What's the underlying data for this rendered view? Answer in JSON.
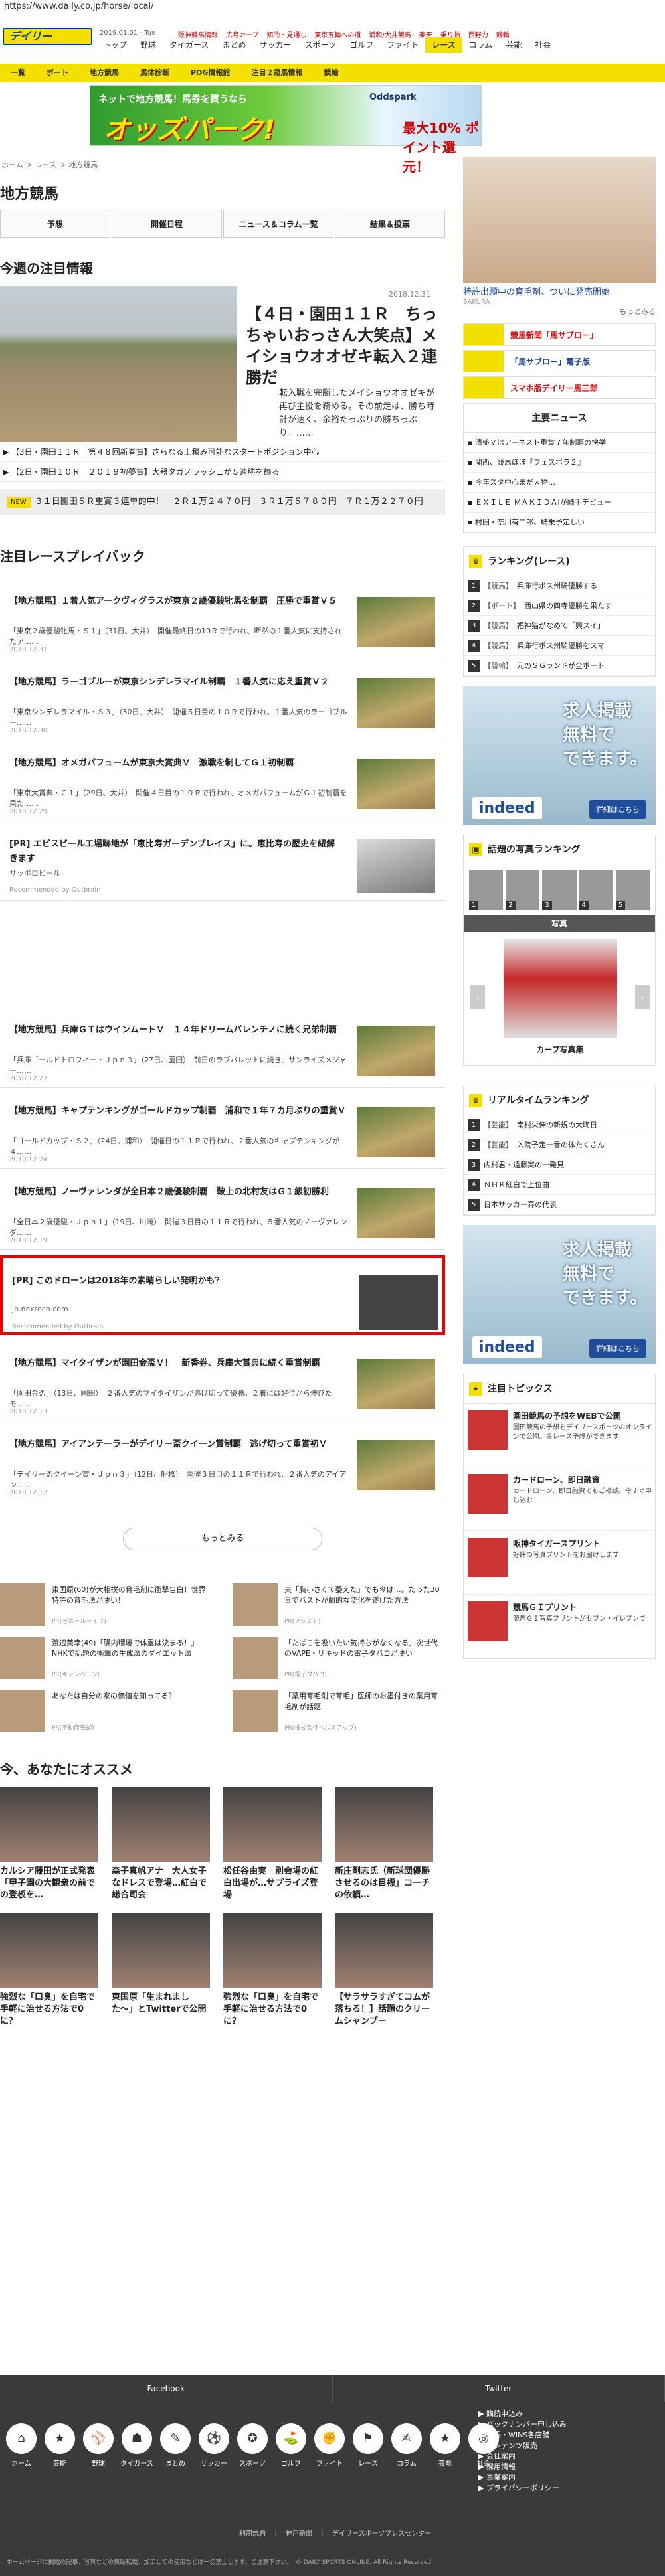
{
  "browser": {
    "url": "https://www.daily.co.jp/horse/local/"
  },
  "header": {
    "logo": "デイリー",
    "date": "2019.01.01 - Tue",
    "top_links": [
      "阪神競馬情報",
      "広島カープ",
      "知的・見通し",
      "東京五輪への道",
      "浦和/大井競馬",
      "楽天",
      "乗り物",
      "西野力",
      "競輪"
    ],
    "nav": [
      "トップ",
      "野球",
      "タイガース",
      "まとめ",
      "サッカー",
      "スポーツ",
      "ゴルフ",
      "ファイト",
      "レース",
      "コラム",
      "芸能",
      "社会"
    ],
    "nav_active": "レース"
  },
  "subnav": [
    "一覧",
    "ボート",
    "地方競馬",
    "馬体診断",
    "POG情報館",
    "注目２歳馬情報",
    "競輪"
  ],
  "banner": {
    "top": "ネットで地方競馬！馬券を買うなら",
    "main": "オッズパーク!",
    "brand": "Oddspark",
    "promo": "最大10% ポイント還元！"
  },
  "breadcrumb": "ホーム ＞ レース ＞ 地方競馬",
  "page_title": "地方競馬",
  "tabs": [
    "予想",
    "開催日程",
    "ニュース＆コラム一覧",
    "結果＆投票"
  ],
  "featured": {
    "section": "今週の注目情報",
    "date": "2018.12.31",
    "headline": "【４日・園田１１Ｒ　ちっちゃいおっさん大笑点】メイショウオオゼキ転入２連勝だ",
    "body": "転入戦を完勝したメイショウオオゼキが再び主役を務める。その前走は、勝ち時計が速く、余裕たっぷりの勝ちっぷり。……",
    "bullets": [
      "【3日・園田１１Ｒ　第４８回新春賞】さらなる上積み可能なスタートポジション中心",
      "【2日・園田１０Ｒ　２０１９初夢賞】大器タガノラッシュが５連勝を飾る"
    ],
    "ticker_tag": "NEW",
    "ticker": "３１日園田５Ｒ重賞３連単的中！　２Ｒ１万２４７０円　３Ｒ１万５７８０円　７Ｒ１万２２７０円"
  },
  "playback": {
    "section": "注目レースプレイバック",
    "articles": [
      {
        "title": "【地方競馬】１着人気アークヴィグラスが東京２歳優駿牝馬を制覇　圧勝で重賞Ｖ５",
        "summary": "「東京２歳優駿牝馬・Ｓ１」（31日、大井）　開催最終日の10Ｒで行われ、断然の１番人気に支持されたア……",
        "date": "2018.12.31"
      },
      {
        "title": "【地方競馬】ラーゴブルーが東京シンデレラマイル制覇　１番人気に応え重賞Ｖ２",
        "summary": "「東京シンデレラマイル・Ｓ３」（30日、大井）　開催５日目の１０Ｒで行われ、１番人気のラーゴブルー……",
        "date": "2018.12.30"
      },
      {
        "title": "【地方競馬】オメガパフュームが東京大賞典Ｖ　激戦を制してＧ１初制覇",
        "summary": "「東京大賞典・Ｇ１」（29日、大井）　開催４日目の１０Ｒで行われ、オメガパフュームがＧ１初制覇を果た……",
        "date": "2018.12.29"
      }
    ],
    "pr1": {
      "title": "[PR] エビスビール工場跡地が「恵比寿ガーデンプレイス」に。恵比寿の歴史を紐解きます",
      "source": "サッポロビール",
      "rec": "Recommended by Outbrain"
    },
    "articles2": [
      {
        "title": "【地方競馬】兵庫ＧＴはウインムートＶ　１４年ドリームバレンチノに続く兄弟制覇",
        "summary": "「兵庫ゴールドトロフィー・Ｊｐｎ３」（27日、園田）　前日のラブバレットに続き、サンライズメジャー……",
        "date": "2018.12.27"
      },
      {
        "title": "【地方競馬】キャプテンキングがゴールドカップ制覇　浦和で１年７カ月ぶりの重賞Ｖ",
        "summary": "「ゴールドカップ・Ｓ２」（24日、浦和）　開催日の１１Ｒで行われ、２番人気のキャプテンキングが４……",
        "date": "2018.12.24"
      },
      {
        "title": "【地方競馬】ノーヴァレンダが全日本２歳優駿制覇　鞍上の北村友はＧ１級初勝利",
        "summary": "「全日本２歳優駿・Ｊｐｎ１」（19日、川崎）　開催３日目の１１Ｒで行われ、５番人気のノーヴァレンダ……",
        "date": "2018.12.19"
      }
    ],
    "pr2": {
      "title": "[PR] このドローンは2018年の素晴らしい発明かも？",
      "source": "jp.nextech.com",
      "rec": "Recommended by Outbrain"
    },
    "articles3": [
      {
        "title": "【地方競馬】マイタイザンが園田金盃Ｖ！　新香券、兵庫大賞典に続く重賞制覇",
        "summary": "「園田金盃」（13日、園田）　２番人気のマイタイザンが逃げ切って優勝。２着には好位から伸びたモ……",
        "date": "2018.12.13"
      },
      {
        "title": "【地方競馬】アイアンテーラーがデイリー盃クイーン賞制覇　逃げ切って重賞初Ｖ",
        "summary": "「デイリー盃クイーン賞・Ｊｐｎ３」（12日、船橋）　開催３日目の１１Ｒで行われ、２番人気のアイアン……",
        "date": "2018.12.12"
      }
    ],
    "more": "もっとみる"
  },
  "recommend_small": [
    {
      "text": "東国原(60)が大相撲の育毛剤に衝撃告白！世界特許の育毛法が凄い！",
      "src": "PR(ゼネラルライフ)"
    },
    {
      "text": "夫「胸小さくて萎えた」でも今は…。たった30日でバストが劇的な変化を遂げた方法",
      "src": "PR(アシスト)"
    },
    {
      "text": "渡辺美幸(49)「腸内環境で体重は決まる！」NHKで話題の衝撃の生成法のダイエット法",
      "src": "PR(キャンペーン)"
    },
    {
      "text": "「たばこを吸いたい気持ちがなくなる」次世代のVAPE・リキッドの電子タバコが凄い",
      "src": "PR(電子タバコ)"
    },
    {
      "text": "あなたは自分の家の価値を知ってる？",
      "src": "PR(不動産売却)"
    },
    {
      "text": "「薬用育毛剤で育毛」医師のお墨付きの薬用育毛剤が話題",
      "src": "PR(株式会社ヘルスアップ)"
    }
  ],
  "osusume": {
    "section": "今、あなたにオススメ",
    "items": [
      "カルシア藤田が正式発表「甲子園の大観衆の前での登板を…",
      "森子真帆アナ　大人女子なドレスで登場…紅白で総合司会",
      "松任谷由実　別会場の紅白出場が…サプライズ登場",
      "新庄剛志氏（新球団優勝させるのは目標」コーチの依頼…",
      "強烈な「口臭」を自宅で手軽に治せる方法で0に？",
      "東国原「生まれました〜」とTwitterで公開",
      "強烈な「口臭」を自宅で手軽に治せる方法で0に？",
      "【サラサラすぎてコムが落ちる！】話題のクリームシャンプー"
    ]
  },
  "right": {
    "ad_caption": "特許出願中の育毛剤、ついに発売開始",
    "ad_src": "SAKURA",
    "ad_more": "もっとみる",
    "promos": [
      "競馬新聞「馬サブロー」",
      "「馬サブロー」電子版",
      "スマホ版デイリー馬三郎"
    ],
    "news_title": "主要ニュース",
    "news": [
      "清盛Ｖはアーネスト重賞７年制覇の快挙",
      "関西、競馬ほぼ『フェスポラ２』",
      "今年スタ中心まだ大物…",
      "ＥＸＩＬＥ ＭＡＫＩＤＡIが騎手デビュー",
      "村田・奈川有二郎、騎乗予定しい"
    ],
    "ranking_title": "ランキング(レース)",
    "ranking": [
      {
        "cat": "【競馬】",
        "text": "兵庫行ポス州騎優勝する"
      },
      {
        "cat": "【ボート】",
        "text": "西山県の四寺優勝を果たす"
      },
      {
        "cat": "【競馬】",
        "text": "福神猫がなめて「興スイ」"
      },
      {
        "cat": "【競馬】",
        "text": "兵庫行ポス州騎優勝をスマ"
      },
      {
        "cat": "【競輪】",
        "text": "元のＳＧランドが全ボート"
      }
    ],
    "job_ad": {
      "line1": "求人掲載",
      "line2": "無料で",
      "line3": "できます。",
      "brand": "indeed",
      "cta": "詳細はこちら"
    },
    "photo_title": "話題の写真ランキング",
    "photo_ranks": [
      "1",
      "2",
      "3",
      "4",
      "5"
    ],
    "photo_label": "写真",
    "photo_caption": "カープ写真集",
    "realtime_title": "リアルタイムランキング",
    "realtime": [
      {
        "cat": "【芸能】",
        "text": "南村栄伸の新規の大晦日"
      },
      {
        "cat": "【芸能】",
        "text": "入院予定一番の体たくさん"
      },
      {
        "cat": "",
        "text": "内村君・遠藤実の一発見"
      },
      {
        "cat": "",
        "text": "ＮＨＫ紅白で上位曲"
      },
      {
        "cat": "",
        "text": "日本サッカー界の代表"
      }
    ],
    "topics_title": "注目トピックス",
    "topics": [
      {
        "title": "園田競馬の予想をWEBで公開",
        "text": "園田競馬の予想をデイリースポーツのオンラインで公開。金レース予想ができます"
      },
      {
        "title": "カードローン、即日融資",
        "text": "カードローン、即日融資でもご相談。今すぐ申し込む"
      },
      {
        "title": "阪神タイガースプリント",
        "text": "好評の写真プリントをお届けします"
      },
      {
        "title": "競馬ＧＩプリント",
        "text": "競馬ＧＩ写真プリントがセブン・イレブンで"
      }
    ]
  },
  "footer": {
    "social": [
      "Facebook",
      "Twitter"
    ],
    "icons": [
      "ホーム",
      "芸能",
      "野球",
      "タイガース",
      "まとめ",
      "サッカー",
      "スポーツ",
      "ゴルフ",
      "ファイト",
      "レース",
      "コラム",
      "芸能",
      "社会"
    ],
    "links": [
      "▶ 購読申込み",
      "▶ バックナンバー申し込み",
      "▶ 競馬・WINS各店舗",
      "▶ コンテンツ販売",
      "▶ 会社案内",
      "▶ 採用情報",
      "▶ 事業案内",
      "▶ プライバシーポリシー"
    ],
    "bar": "利用規約　｜　神戸新聞　｜　デイリースポーツプレスセンター",
    "copyright": "ホームページに掲載の記事、写真などの無断転載、加工しての使用などは一切禁止します。ご注意下さい。　© DAILY SPORTS ONLINE. All Rights Reserved."
  }
}
